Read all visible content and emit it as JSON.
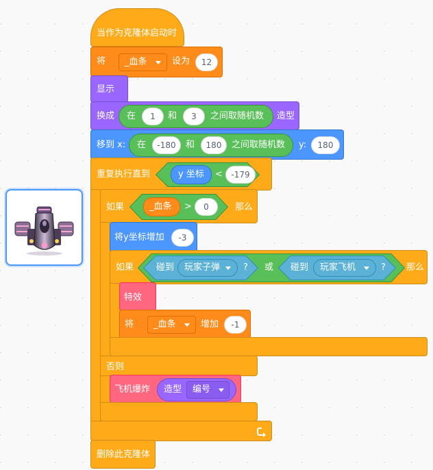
{
  "script": {
    "hat_label": "当作为克隆体启动时",
    "set_var": {
      "label_prefix": "将",
      "variable": "_血条",
      "label_mid": "设为",
      "value": "12"
    },
    "show_label": "显示",
    "switch_costume": {
      "label": "换成",
      "random": {
        "label_in": "在",
        "from": "1",
        "and": "和",
        "to": "3",
        "suffix": "之间取随机数"
      },
      "label_suffix": "造型"
    },
    "goto_xy": {
      "label": "移到 x:",
      "random": {
        "label_in": "在",
        "from": "-180",
        "and": "和",
        "to": "180",
        "suffix": "之间取随机数"
      },
      "y_label": "y:",
      "y_value": "180"
    },
    "repeat_until": {
      "label": "重复执行直到",
      "condition": {
        "reporter": "y 坐标",
        "op": "<",
        "value": "-179"
      }
    },
    "if_else": {
      "if_label": "如果",
      "condition": {
        "variable": "_血条",
        "op": ">",
        "value": "0"
      },
      "then_label": "那么",
      "else_label": "否则"
    },
    "change_y": {
      "label": "将y坐标增加",
      "value": "-3"
    },
    "inner_if": {
      "if_label": "如果",
      "touch_a": {
        "label": "碰到",
        "target": "玩家子弹",
        "q": "?"
      },
      "or_label": "或",
      "touch_b": {
        "label": "碰到",
        "target": "玩家飞机",
        "q": "?"
      },
      "then_label": "那么"
    },
    "effect_label": "特效",
    "change_var": {
      "label_prefix": "将",
      "variable": "_血条",
      "label_mid": "增加",
      "value": "-1"
    },
    "explode": {
      "label": "飞机爆炸",
      "costume_label": "造型",
      "costume_option": "编号"
    },
    "delete_clone_label": "删除此克隆体",
    "loop_icon": "loop-arrow-icon"
  },
  "sprite": {
    "icon": "spaceship-sprite-icon"
  },
  "colors": {
    "control": "#ffab19",
    "variables": "#ff8c1a",
    "looks": "#9966ff",
    "motion": "#4c97ff",
    "operators": "#59c059",
    "sensing": "#5cb1d6",
    "custom": "#ff6680"
  }
}
